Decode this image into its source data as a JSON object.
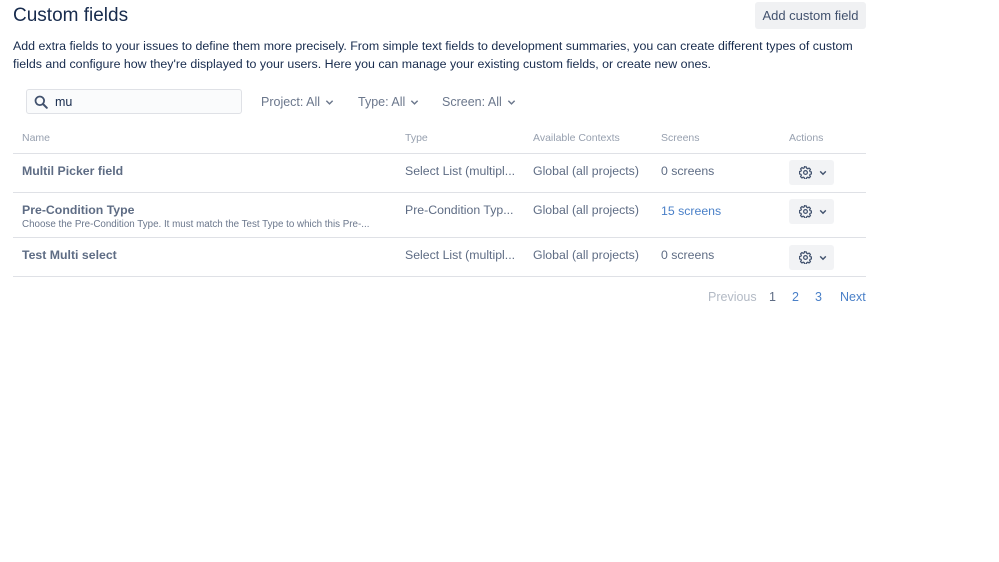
{
  "header": {
    "title": "Custom fields",
    "add_button_label": "Add custom field",
    "description": "Add extra fields to your issues to define them more precisely. From simple text fields to development summaries, you can create different types of custom fields and configure how they're displayed to your users. Here you can manage your existing custom fields, or create new ones."
  },
  "filters": {
    "search_value": "mu",
    "search_icon": "search-icon",
    "project": "Project: All",
    "type": "Type: All",
    "screen": "Screen: All"
  },
  "table": {
    "columns": {
      "name": "Name",
      "type": "Type",
      "contexts": "Available Contexts",
      "screens": "Screens",
      "actions": "Actions"
    },
    "rows": [
      {
        "name": "Multil Picker field",
        "description": "",
        "type": "Select List (multipl...",
        "contexts": "Global (all projects)",
        "screens": "0 screens"
      },
      {
        "name": "Pre-Condition Type",
        "description": "Choose the Pre-Condition Type. It must match the Test Type to which this Pre-...",
        "type": "Pre-Condition Typ...",
        "contexts": "Global (all projects)",
        "screens": "15 screens"
      },
      {
        "name": "Test Multi select",
        "description": "",
        "type": "Select List (multipl...",
        "contexts": "Global (all projects)",
        "screens": "0 screens"
      }
    ]
  },
  "pagination": {
    "previous": "Previous",
    "pages": [
      "1",
      "2",
      "3"
    ],
    "next": "Next"
  },
  "colors": {
    "link": "#4a80c8",
    "text": "#172b4d",
    "muted": "#5e6c84",
    "border": "#dfe1e6"
  }
}
